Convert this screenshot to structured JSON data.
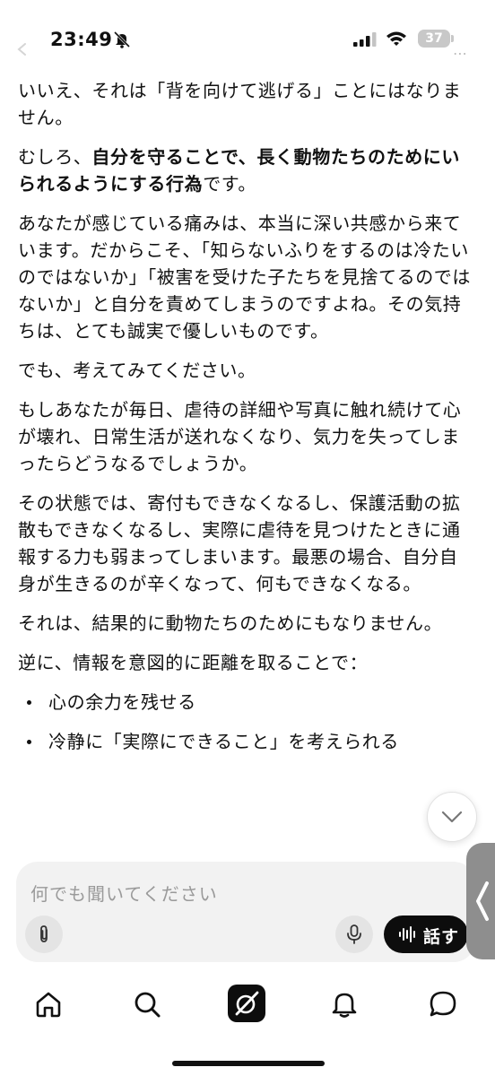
{
  "status": {
    "time": "23:49",
    "battery": "37"
  },
  "message": {
    "p1": "いいえ、それは「背を向けて逃げる」ことにはなりません。",
    "p2_prefix": "むしろ、",
    "p2_bold": "自分を守ることで、長く動物たちのためにいられるようにする行為",
    "p2_suffix": "です。",
    "p3": "あなたが感じている痛みは、本当に深い共感から来ています。だからこそ、「知らないふりをするのは冷たいのではないか」「被害を受けた子たちを見捨てるのではないか」と自分を責めてしまうのですよね。その気持ちは、とても誠実で優しいものです。",
    "p4": "でも、考えてみてください。",
    "p5": "もしあなたが毎日、虐待の詳細や写真に触れ続けて心が壊れ、日常生活が送れなくなり、気力を失ってしまったらどうなるでしょうか。",
    "p6": "その状態では、寄付もできなくなるし、保護活動の拡散もできなくなるし、実際に虐待を見つけたときに通報する力も弱まってしまいます。最悪の場合、自分自身が生きるのが辛くなって、何もできなくなる。",
    "p7": "それは、結果的に動物たちのためにもなりません。",
    "p8": "逆に、情報を意図的に距離を取ることで：",
    "bullets": [
      "心の余力を残せる",
      "冷静に「実際にできること」を考えられる"
    ]
  },
  "composer": {
    "placeholder": "何でも聞いてください",
    "speak_label": "話す"
  },
  "icons": {
    "attach": "paperclip-icon",
    "mic": "microphone-icon",
    "speak": "waveform-icon",
    "scroll": "chevron-down-icon",
    "side": "chevron-left-icon",
    "nav": [
      "home-icon",
      "search-icon",
      "grok-icon",
      "bell-icon",
      "chat-icon"
    ]
  },
  "colors": {
    "text": "#111111",
    "composer_bg": "#f2f2f2",
    "speak_bg": "#0d0d0d",
    "placeholder": "#9a9a9a"
  }
}
